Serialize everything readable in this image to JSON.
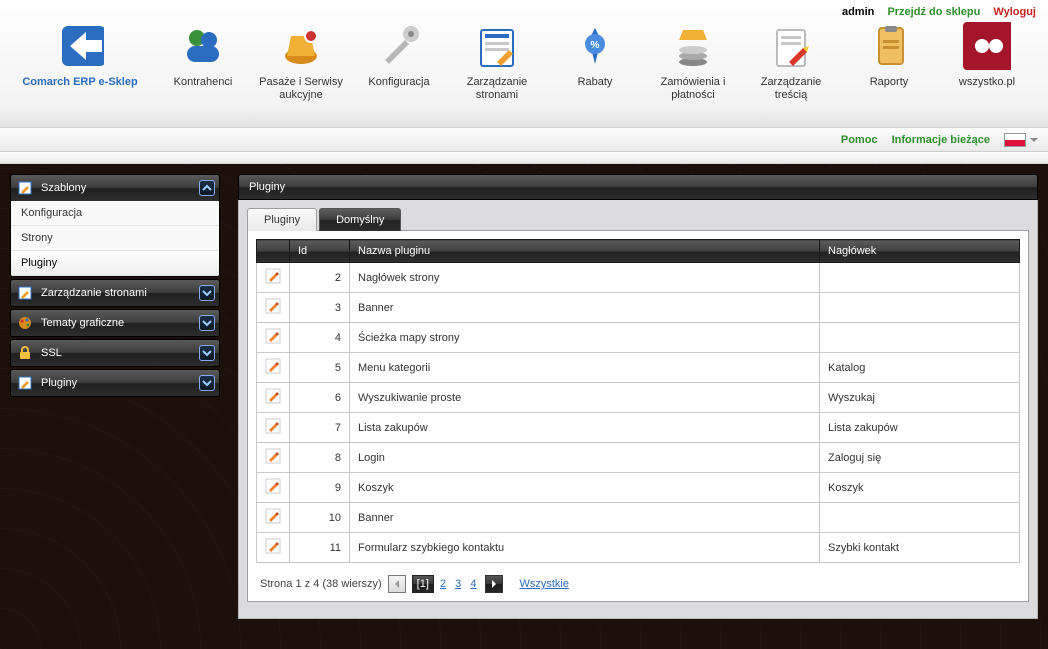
{
  "toplinks": {
    "user": "admin",
    "shop": "Przejdź do sklepu",
    "logout": "Wyloguj"
  },
  "topnav": [
    {
      "key": "logo",
      "label": "Comarch ERP e-Sklep",
      "blue": true
    },
    {
      "key": "kontrahenci",
      "label": "Kontrahenci"
    },
    {
      "key": "pasaze",
      "label": "Pasaże i Serwisy aukcyjne"
    },
    {
      "key": "konfiguracja",
      "label": "Konfiguracja"
    },
    {
      "key": "zarzstron",
      "label": "Zarządzanie stronami"
    },
    {
      "key": "rabaty",
      "label": "Rabaty"
    },
    {
      "key": "zamow",
      "label": "Zamówienia i płatności"
    },
    {
      "key": "zarztresc",
      "label": "Zarządzanie treścią"
    },
    {
      "key": "raporty",
      "label": "Raporty"
    },
    {
      "key": "wszystko",
      "label": "wszystko.pl"
    }
  ],
  "subbar": {
    "help": "Pomoc",
    "info": "Informacje bieżące"
  },
  "sidebar": {
    "accordion": [
      {
        "key": "szablony",
        "label": "Szablony",
        "open": true,
        "items": [
          {
            "label": "Konfiguracja",
            "active": false
          },
          {
            "label": "Strony",
            "active": false
          },
          {
            "label": "Pluginy",
            "active": true
          }
        ]
      },
      {
        "key": "zarzstron",
        "label": "Zarządzanie stronami",
        "open": false
      },
      {
        "key": "tematy",
        "label": "Tematy graficzne",
        "open": false
      },
      {
        "key": "ssl",
        "label": "SSL",
        "open": false
      },
      {
        "key": "pluginy",
        "label": "Pluginy",
        "open": false
      }
    ]
  },
  "main": {
    "title": "Pluginy",
    "tabs": [
      {
        "label": "Pluginy",
        "active": true
      },
      {
        "label": "Domyślny",
        "active": false
      }
    ],
    "columns": {
      "id": "Id",
      "name": "Nazwa pluginu",
      "header": "Nagłówek"
    },
    "rows": [
      {
        "id": 2,
        "name": "Nagłówek strony",
        "header": ""
      },
      {
        "id": 3,
        "name": "Banner",
        "header": ""
      },
      {
        "id": 4,
        "name": "Ścieżka mapy strony",
        "header": ""
      },
      {
        "id": 5,
        "name": "Menu kategorii",
        "header": "Katalog"
      },
      {
        "id": 6,
        "name": "Wyszukiwanie proste",
        "header": "Wyszukaj"
      },
      {
        "id": 7,
        "name": "Lista zakupów",
        "header": "Lista zakupów"
      },
      {
        "id": 8,
        "name": "Login",
        "header": "Zaloguj się"
      },
      {
        "id": 9,
        "name": "Koszyk",
        "header": "Koszyk"
      },
      {
        "id": 10,
        "name": "Banner",
        "header": ""
      },
      {
        "id": 11,
        "name": "Formularz szybkiego kontaktu",
        "header": "Szybki kontakt"
      }
    ],
    "pager": {
      "text": "Strona 1 z 4 (38 wierszy)",
      "pages": [
        "[1]",
        "2",
        "3",
        "4"
      ],
      "all": "Wszystkie"
    }
  }
}
